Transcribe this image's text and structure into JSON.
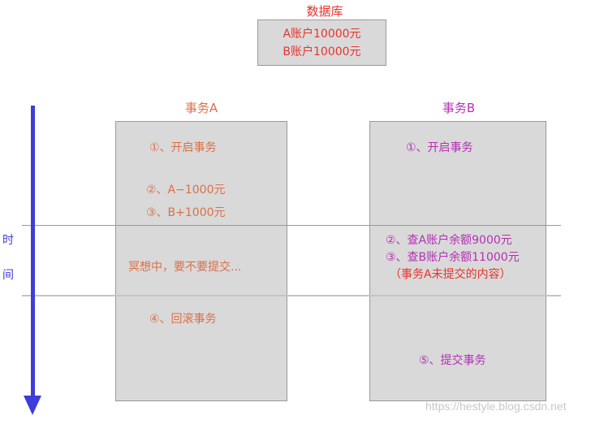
{
  "database": {
    "title": "数据库",
    "rows": [
      "A账户10000元",
      "B账户10000元"
    ]
  },
  "transaction_a": {
    "title": "事务A",
    "steps": [
      "①、开启事务",
      "②、A−1000元",
      "③、B+1000元",
      "冥想中，要不要提交...",
      "④、回滚事务"
    ]
  },
  "transaction_b": {
    "title": "事务B",
    "steps": [
      "①、开启事务",
      "②、查A账户余额9000元",
      "③、查B账户余额11000元",
      "⑤、提交事务"
    ],
    "note": "（事务A未提交的内容）"
  },
  "time_axis": {
    "label_chars": [
      "时",
      "间"
    ]
  },
  "watermark": "https://hestyle.blog.csdn.net",
  "colors": {
    "database_text": "#e8332d",
    "transaction_a_text": "#d9704a",
    "transaction_b_text": "#b530b5",
    "note_text": "#e8332d",
    "time_axis": "#3d3ddb",
    "box_fill": "#d9d9d9"
  }
}
